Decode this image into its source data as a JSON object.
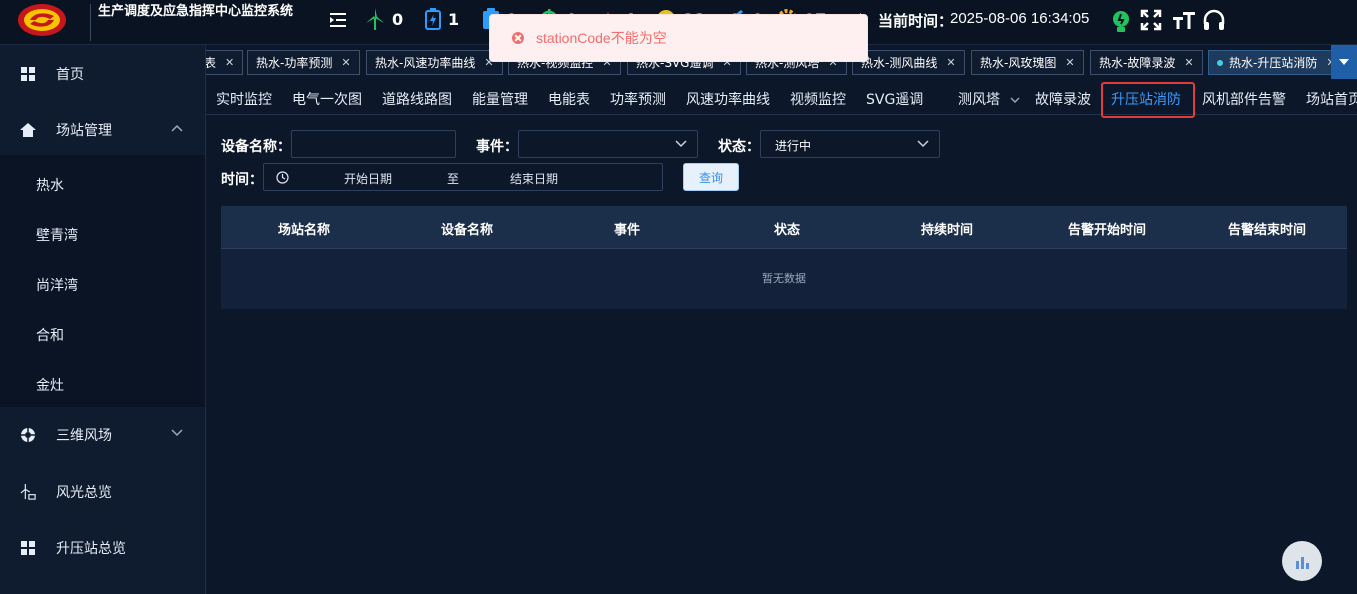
{
  "header": {
    "title": "生产调度及应急指挥中心监控系统",
    "stats": [
      {
        "icon": "wind-turbine-icon",
        "value": "0"
      },
      {
        "icon": "battery-icon",
        "value": "1"
      },
      {
        "icon": "clipboard-icon",
        "value": "0"
      },
      {
        "icon": "power-icon",
        "value": "0"
      },
      {
        "icon": "alarm-icon",
        "value": "4"
      },
      {
        "icon": "wrench-icon",
        "value": "21"
      },
      {
        "icon": "link-icon",
        "value": "0"
      },
      {
        "icon": "gear-icon",
        "value": "97"
      }
    ],
    "time_label": "当前时间：",
    "time_value": "2025-08-06 16:34:05"
  },
  "toast": {
    "message": "stationCode不能为空",
    "type": "error"
  },
  "sidebar": {
    "items": [
      {
        "label": "首页",
        "icon": "grid-icon"
      },
      {
        "label": "场站管理",
        "icon": "home-icon",
        "expanded": true
      },
      {
        "label": "三维风场",
        "icon": "aperture-icon",
        "expanded": false
      },
      {
        "label": "风光总览",
        "icon": "wind-turbine-icon"
      },
      {
        "label": "升压站总览",
        "icon": "grid-icon"
      }
    ],
    "station_sub_items": [
      "热水",
      "壁青湾",
      "尚洋湾",
      "合和",
      "金灶"
    ]
  },
  "tabs": [
    {
      "label": "表"
    },
    {
      "label": "热水-功率预测"
    },
    {
      "label": "热水-风速功率曲线"
    },
    {
      "label": "热水-视频监控"
    },
    {
      "label": "热水-SVG遥调"
    },
    {
      "label": "热水-测风塔"
    },
    {
      "label": "热水-测风曲线"
    },
    {
      "label": "热水-风玫瑰图"
    },
    {
      "label": "热水-故障录波"
    },
    {
      "label": "热水-升压站消防",
      "active": true
    }
  ],
  "nav": [
    "实时监控",
    "电气一次图",
    "道路线路图",
    "能量管理",
    "电能表",
    "功率预测",
    "风速功率曲线",
    "视频监控",
    "SVG遥调",
    "测风塔",
    "故障录波",
    "升压站消防",
    "风机部件告警",
    "场站首页"
  ],
  "nav_active_index": 11,
  "filters": {
    "device_label": "设备名称：",
    "device_value": "",
    "event_label": "事件：",
    "event_value": "",
    "status_label": "状态：",
    "status_value": "进行中",
    "time_label": "时间：",
    "start_placeholder": "开始日期",
    "range_separator": "至",
    "end_placeholder": "结束日期",
    "query_button": "查询"
  },
  "table": {
    "columns": [
      "场站名称",
      "设备名称",
      "事件",
      "状态",
      "持续时间",
      "告警开始时间",
      "告警结束时间"
    ],
    "rows": [],
    "empty_text": "暂无数据"
  },
  "colors": {
    "accent": "#3b9bff",
    "error": "#f56c6c",
    "active_outline": "#e23b3b",
    "background": "#0c1729"
  }
}
